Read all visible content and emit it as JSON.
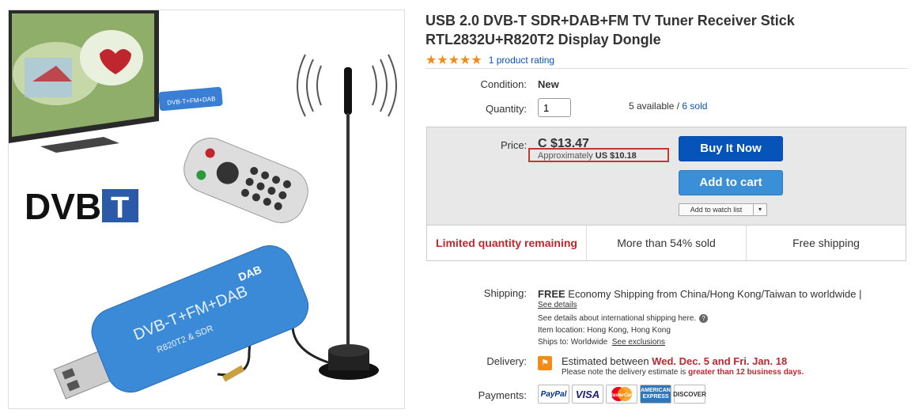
{
  "product": {
    "title_line1": "USB 2.0 DVB-T SDR+DAB+FM TV Tuner Receiver Stick",
    "title_line2": "RTL2832U+R820T2 Display Dongle",
    "stars": "★★★★★",
    "rating_text": "1 product rating"
  },
  "image": {
    "logo_dvb": "DVB",
    "logo_t": "T",
    "stick_text": "DVB-T+FM+DAB",
    "stick_subtext": "R820T2 & SDR",
    "stick_badge": "DAB"
  },
  "condition": {
    "label": "Condition:",
    "value": "New"
  },
  "quantity": {
    "label": "Quantity:",
    "value": "1",
    "available": "5 available / ",
    "sold_link": "6 sold"
  },
  "price": {
    "label": "Price:",
    "value": "C $13.47",
    "approx_prefix": "Approximately ",
    "approx_value": "US $10.18"
  },
  "buttons": {
    "buy_now": "Buy It Now",
    "add_to_cart": "Add to cart",
    "watch_list": "Add to watch list",
    "watch_dropdown": "▾"
  },
  "promo": {
    "limited": "Limited quantity remaining",
    "sold_pct": "More than 54% sold",
    "free_shipping": "Free shipping"
  },
  "shipping": {
    "label": "Shipping:",
    "free": "FREE",
    "desc": " Economy Shipping from China/Hong Kong/Taiwan to worldwide |",
    "see_details": "See details",
    "intl_note": "See details about international shipping here.",
    "help": "?",
    "location_label": "Item location:",
    "location_value": "Hong Kong, Hong Kong",
    "ships_to_label": "Ships to:",
    "ships_to_value": "Worldwide",
    "see_exclusions": "See exclusions"
  },
  "delivery": {
    "label": "Delivery:",
    "prefix": "Estimated between ",
    "dates": "Wed. Dec. 5 and Fri. Jan. 18",
    "note_prefix": "Please note the delivery estimate is ",
    "note_warn": "greater than 12 business days."
  },
  "payments": {
    "label": "Payments:",
    "paypal": "PayPal",
    "visa": "VISA",
    "mastercard": "MasterCard",
    "amex": "AMERICAN EXPRESS",
    "discover": "DISCOVER"
  }
}
